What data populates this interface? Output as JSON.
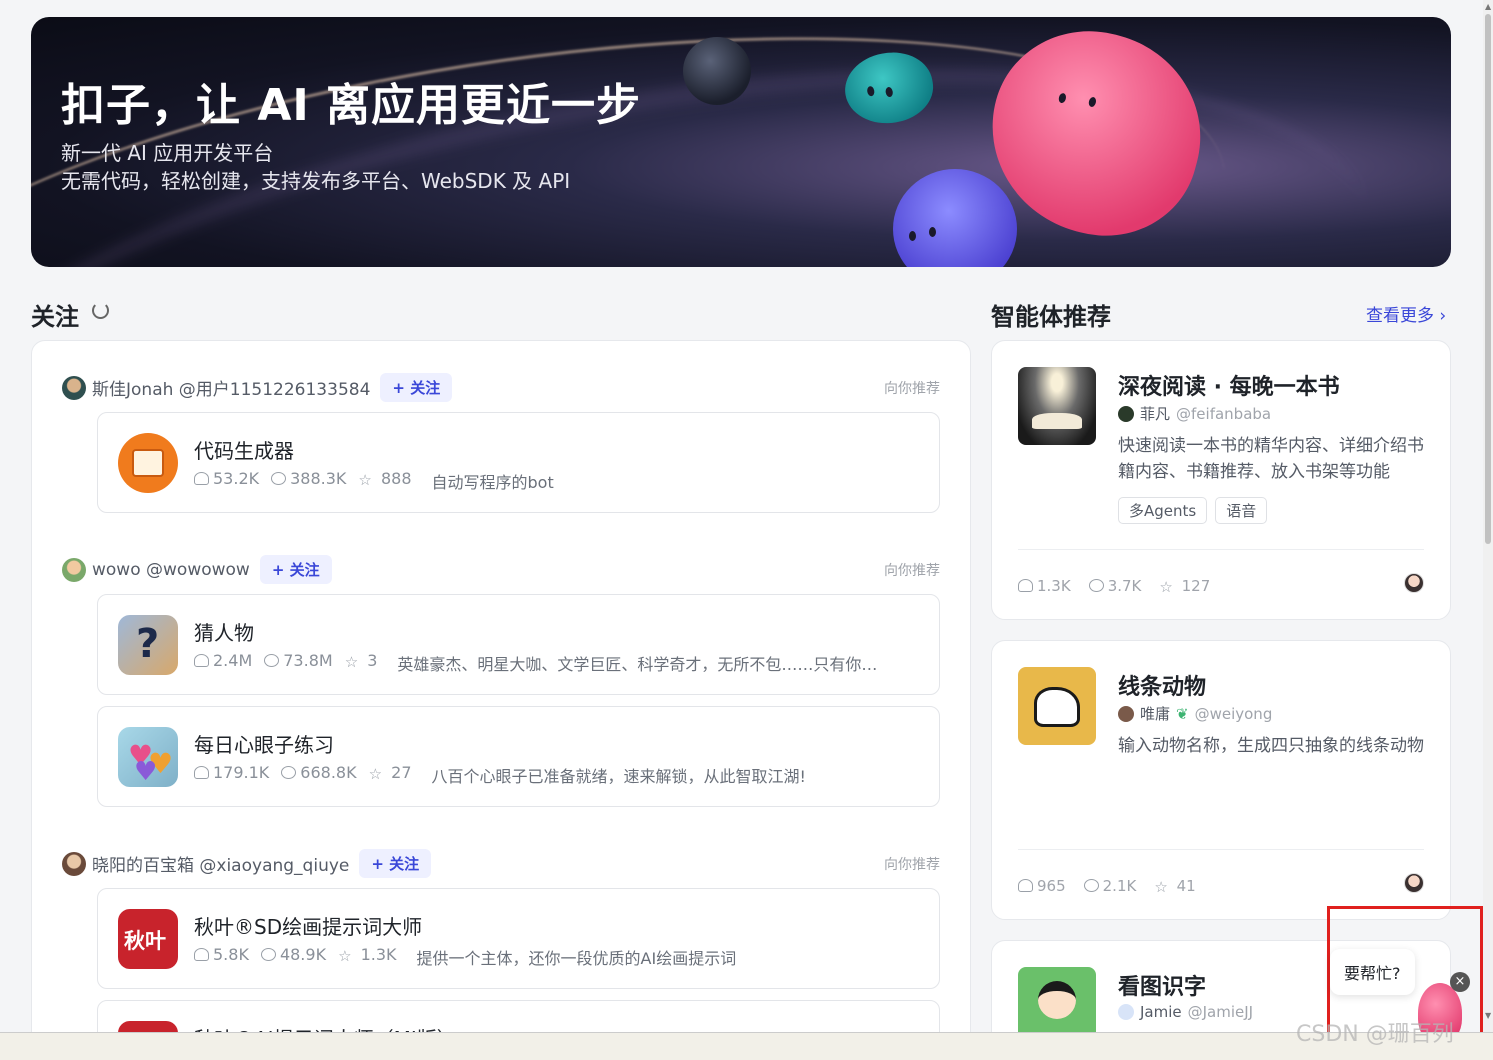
{
  "banner": {
    "title": "扣子，让 AI 离应用更近一步",
    "subtitle1": "新一代 AI 应用开发平台",
    "subtitle2": "无需代码，轻松创建，支持发布多平台、WebSDK 及 API"
  },
  "follow": {
    "title": "关注",
    "follow_label": "+ 关注",
    "recommend_label": "向你推荐",
    "posts": [
      {
        "user": "斯佳Jonah @用户1151226133584",
        "bots": [
          {
            "name": "代码生成器",
            "users": "53.2K",
            "chats": "388.3K",
            "stars": "888",
            "desc": "自动写程序的bot",
            "icon_color": "#f07b1d"
          }
        ]
      },
      {
        "user": "wowo @wowowow",
        "bots": [
          {
            "name": "猜人物",
            "users": "2.4M",
            "chats": "73.8M",
            "stars": "3",
            "desc": "英雄豪杰、明星大咖、文学巨匠、科学奇才，无所不包……只有你…",
            "icon_color": "#6a8fb8"
          },
          {
            "name": "每日心眼子练习",
            "users": "179.1K",
            "chats": "668.8K",
            "stars": "27",
            "desc": "八百个心眼子已准备就绪，速来解锁，从此智取江湖!",
            "icon_color": "#8fc8d8"
          }
        ]
      },
      {
        "user": "晓阳的百宝箱 @xiaoyang_qiuye",
        "bots": [
          {
            "name": "秋叶®SD绘画提示词大师",
            "users": "5.8K",
            "chats": "48.9K",
            "stars": "1.3K",
            "desc": "提供一个主体，还你一段优质的AI绘画提示词",
            "icon_color": "#c8232c",
            "icon_text": "秋叶"
          },
          {
            "name": "秋叶®AI提示词大师（MJ版）",
            "users": "",
            "chats": "",
            "stars": "",
            "desc": "",
            "icon_color": "#c8232c"
          }
        ]
      }
    ]
  },
  "recommend": {
    "title": "智能体推荐",
    "more_label": "查看更多 ›",
    "cards": [
      {
        "title": "深夜阅读 · 每晚一本书",
        "author": "菲凡",
        "handle": "@feifanbaba",
        "desc": "快速阅读一本书的精华内容、详细介绍书籍内容、书籍推荐、放入书架等功能",
        "tags": [
          "多Agents",
          "语音"
        ],
        "users": "1.3K",
        "chats": "3.7K",
        "stars": "127"
      },
      {
        "title": "线条动物",
        "author": "唯庸",
        "handle": "@weiyong",
        "desc": "输入动物名称，生成四只抽象的线条动物",
        "tags": [],
        "users": "965",
        "chats": "2.1K",
        "stars": "41"
      },
      {
        "title": "看图识字",
        "author": "Jamie",
        "handle": "@JamieJJ"
      }
    ]
  },
  "help": {
    "label": "要帮忙?",
    "close": "×"
  },
  "watermark": "CSDN @珊百列"
}
